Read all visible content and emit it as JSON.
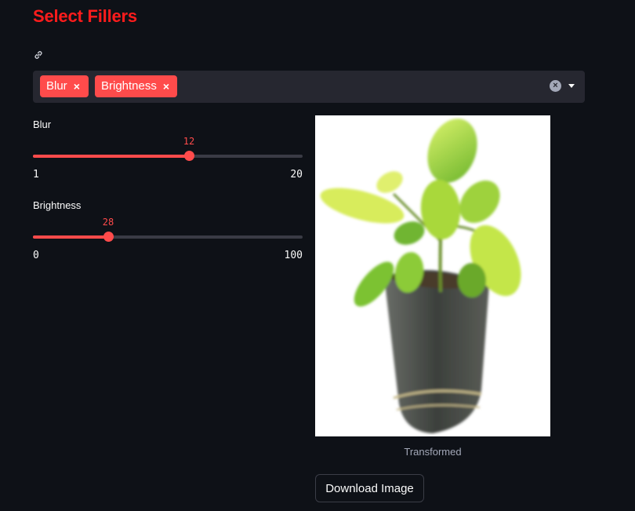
{
  "header": {
    "title": "Select Fillers"
  },
  "filters": {
    "selected": [
      {
        "label": "Blur",
        "remove": "×"
      },
      {
        "label": "Brightness",
        "remove": "×"
      }
    ],
    "clear_symbol": "×"
  },
  "sliders": [
    {
      "label": "Blur",
      "value": 12,
      "min": 1,
      "max": 20
    },
    {
      "label": "Brightness",
      "value": 28,
      "min": 0,
      "max": 100
    }
  ],
  "image": {
    "caption": "Transformed",
    "subject": "potted-plant-photo"
  },
  "actions": {
    "download_label": "Download Image"
  },
  "colors": {
    "accent": "#ff4b4b",
    "title": "#ff1c1c",
    "background": "#0e1117",
    "input_bg": "#262730"
  }
}
